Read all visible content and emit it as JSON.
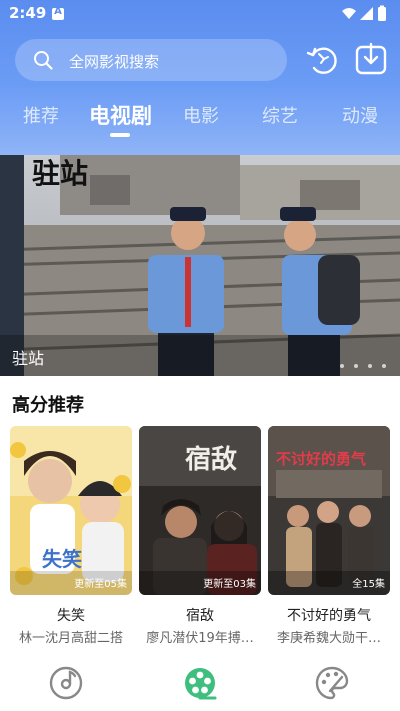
{
  "status_bar": {
    "time": "2:49",
    "notification_badge": "A"
  },
  "search": {
    "placeholder": "全网影视搜索"
  },
  "tabs": [
    {
      "label": "推荐",
      "active": false
    },
    {
      "label": "电视剧",
      "active": true
    },
    {
      "label": "电影",
      "active": false
    },
    {
      "label": "综艺",
      "active": false
    },
    {
      "label": "动漫",
      "active": false
    }
  ],
  "banner": {
    "title": "驻站",
    "poster_text": "驻站",
    "page_count": 4,
    "active_page": 1
  },
  "section": {
    "title": "高分推荐"
  },
  "cards": [
    {
      "title": "失笑",
      "subtitle": "林一沈月高甜二搭",
      "badge": "更新至05集",
      "poster_text": "失笑"
    },
    {
      "title": "宿敌",
      "subtitle": "廖凡潜伏19年搏…",
      "badge": "更新至03集",
      "poster_text": "宿敌"
    },
    {
      "title": "不讨好的勇气",
      "subtitle": "李庚希魏大勋干…",
      "badge": "全15集",
      "poster_text": "不讨好的勇气"
    }
  ],
  "bottom_nav": [
    {
      "icon": "music-disc-icon",
      "active": false
    },
    {
      "icon": "film-reel-icon",
      "active": true
    },
    {
      "icon": "palette-icon",
      "active": false
    }
  ],
  "colors": {
    "header_top": "#5b8df0",
    "header_bottom": "#8fb4f7",
    "active_nav": "#3fbf7f",
    "inactive_nav": "#888888"
  }
}
